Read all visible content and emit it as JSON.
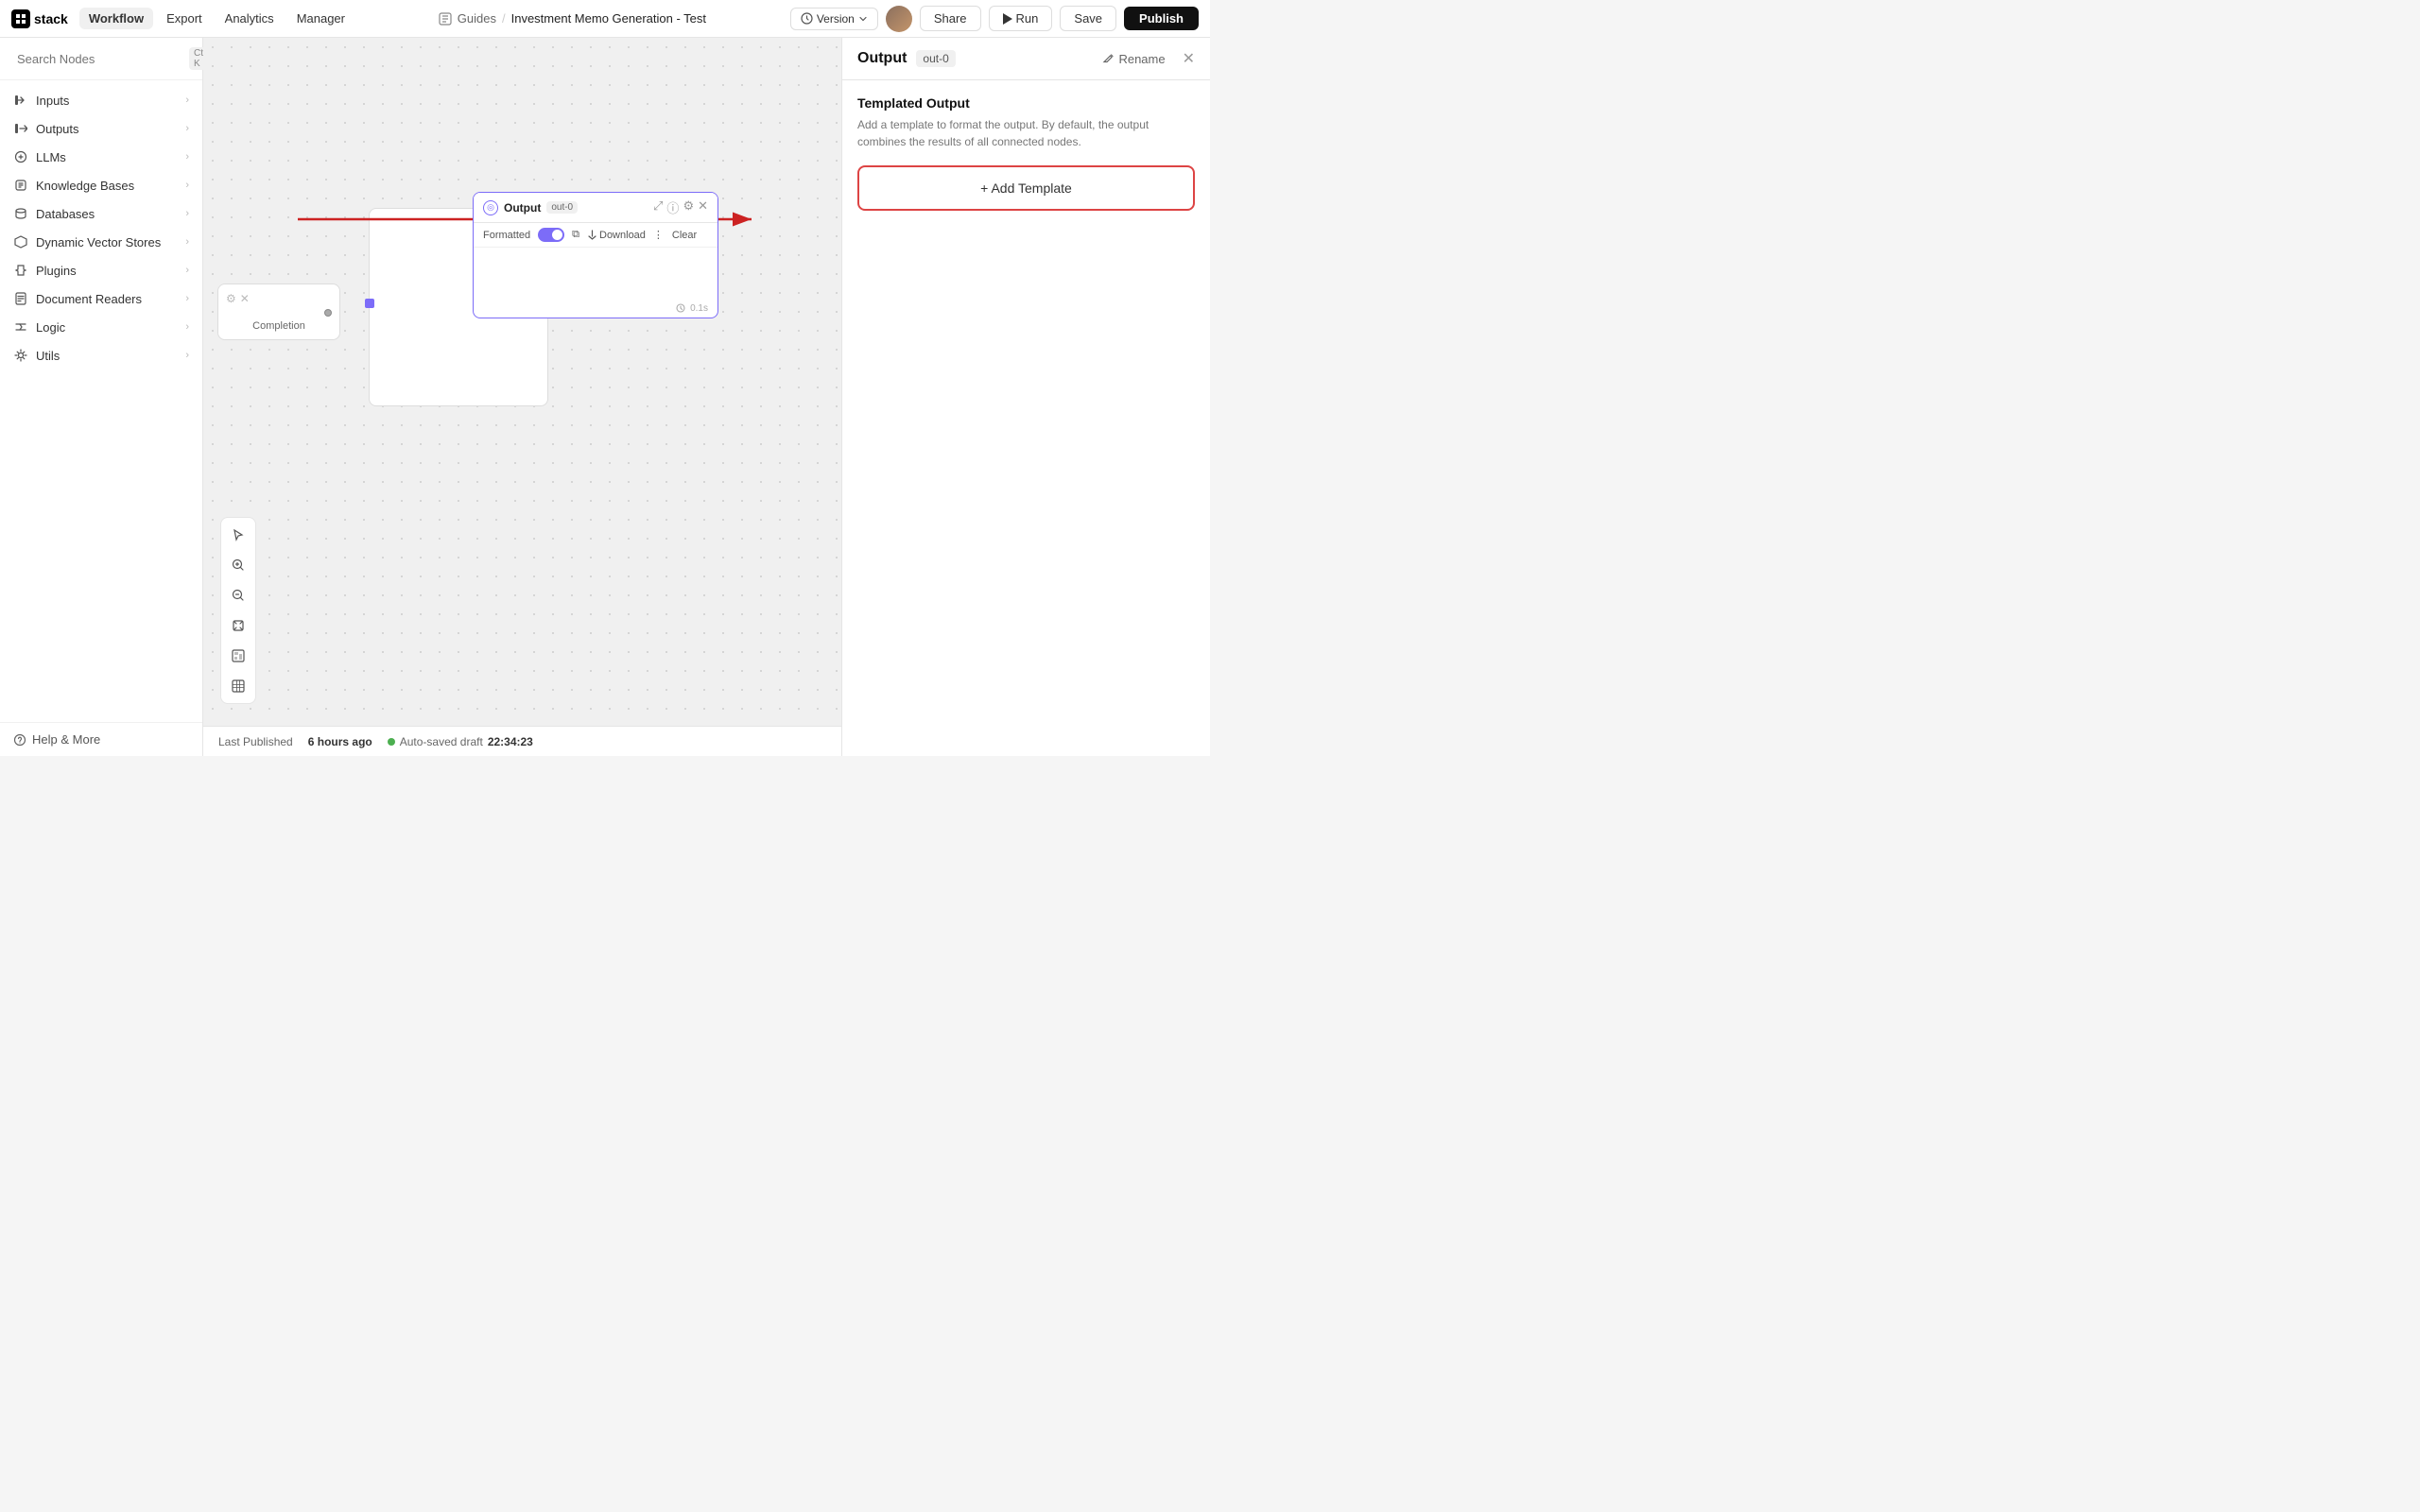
{
  "app": {
    "logo_text": "stack"
  },
  "topnav": {
    "tabs": [
      {
        "id": "workflow",
        "label": "Workflow",
        "active": true
      },
      {
        "id": "export",
        "label": "Export",
        "active": false
      },
      {
        "id": "analytics",
        "label": "Analytics",
        "active": false
      },
      {
        "id": "manager",
        "label": "Manager",
        "active": false
      }
    ],
    "breadcrumb_folder": "Guides",
    "breadcrumb_sep": "/",
    "breadcrumb_title": "Investment Memo Generation - Test",
    "version_label": "Version",
    "share_label": "Share",
    "run_label": "Run",
    "save_label": "Save",
    "publish_label": "Publish"
  },
  "sidebar": {
    "search_placeholder": "Search Nodes",
    "search_shortcut": "Ctrl K",
    "items": [
      {
        "id": "inputs",
        "label": "Inputs"
      },
      {
        "id": "outputs",
        "label": "Outputs"
      },
      {
        "id": "llms",
        "label": "LLMs"
      },
      {
        "id": "knowledge-bases",
        "label": "Knowledge Bases"
      },
      {
        "id": "databases",
        "label": "Databases"
      },
      {
        "id": "dynamic-vector-stores",
        "label": "Dynamic Vector Stores"
      },
      {
        "id": "plugins",
        "label": "Plugins"
      },
      {
        "id": "document-readers",
        "label": "Document Readers"
      },
      {
        "id": "logic",
        "label": "Logic"
      },
      {
        "id": "utils",
        "label": "Utils"
      }
    ],
    "footer_label": "Help & More"
  },
  "canvas": {
    "node_output": {
      "title": "Output",
      "badge": "out-0",
      "formatted_label": "Formatted",
      "download_label": "Download",
      "clear_label": "Clear",
      "timer": "0.1s"
    },
    "node_completion_label": "Completion"
  },
  "statusbar": {
    "last_published_label": "Last Published",
    "last_published_time": "6 hours ago",
    "autosaved_label": "Auto-saved draft",
    "autosaved_time": "22:34:23"
  },
  "right_panel": {
    "title": "Output",
    "badge": "out-0",
    "rename_label": "Rename",
    "section_title": "Templated Output",
    "section_desc": "Add a template to format the output. By default, the output combines the results of all connected nodes.",
    "add_template_label": "+ Add Template"
  }
}
